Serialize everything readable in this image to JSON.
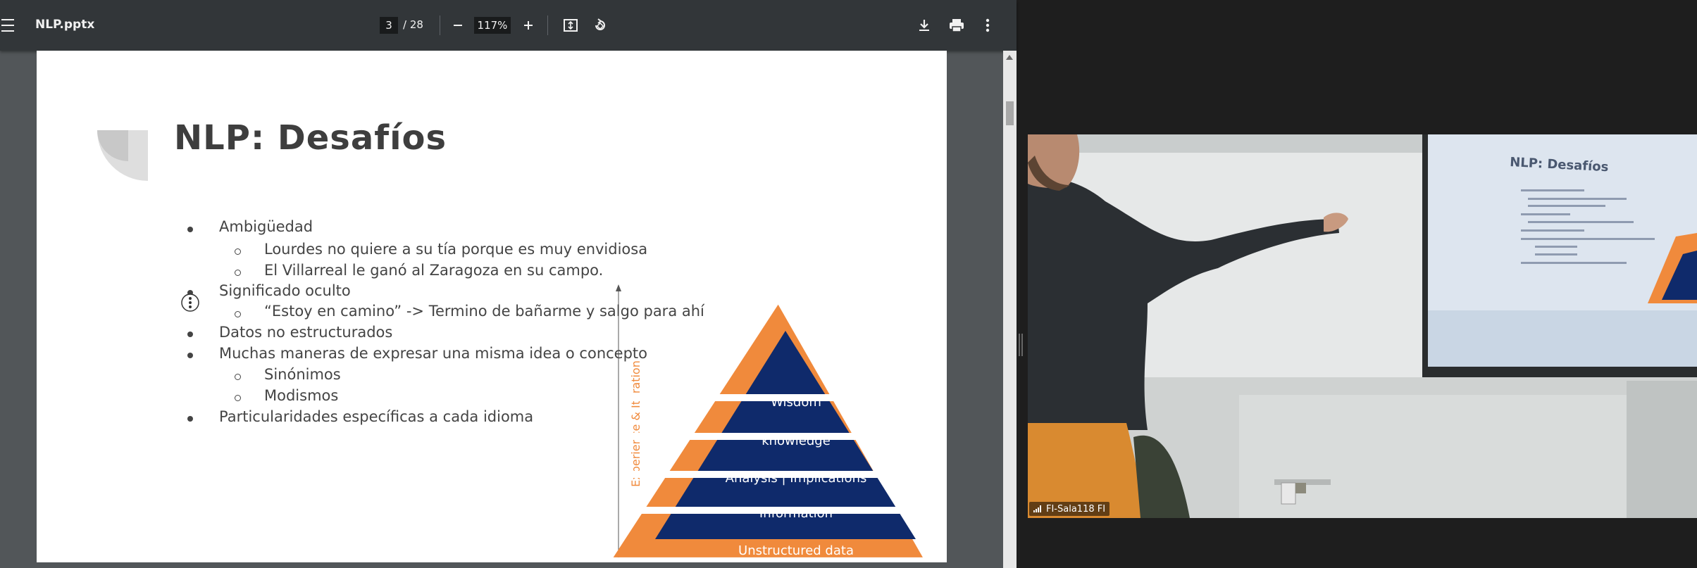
{
  "toolbar": {
    "file_name": "NLP.pptx",
    "page_current": "3",
    "page_total": "/ 28",
    "zoom": "117%"
  },
  "slide": {
    "title": "NLP: Desafíos",
    "bullets": [
      {
        "level": 1,
        "text": "Ambigüedad"
      },
      {
        "level": 2,
        "text": "Lourdes no quiere a su tía porque es muy envidiosa"
      },
      {
        "level": 2,
        "text": "El Villarreal le ganó al Zaragoza en su campo."
      },
      {
        "level": 1,
        "text": "Significado oculto"
      },
      {
        "level": 2,
        "text": "“Estoy en camino” -> Termino de bañarme y salgo para ahí"
      },
      {
        "level": 1,
        "text": "Datos no estructurados"
      },
      {
        "level": 1,
        "text": "Muchas maneras de expresar una misma idea o concepto"
      },
      {
        "level": 2,
        "text": "Sinónimos"
      },
      {
        "level": 2,
        "text": "Modismos"
      },
      {
        "level": 1,
        "text": "Particularidades específicas a cada idioma"
      }
    ],
    "pyramid": {
      "axis_label": "Experience & Iteration",
      "levels": [
        "Wisdom",
        "knowledge",
        "Analysis | Implications",
        "Information",
        "Unstructured data"
      ],
      "colors": {
        "border": "#f08a3c",
        "fill": "#0f2a6b",
        "text": "#ffffff"
      }
    }
  },
  "webcam": {
    "label": "FI-Sala118 FI",
    "projected_title": "NLP: Desafíos"
  },
  "colors": {
    "toolbar_bg": "#323639",
    "viewer_bg": "#525659",
    "accent_orange": "#f08a3c",
    "pyramid_navy": "#0f2a6b"
  }
}
